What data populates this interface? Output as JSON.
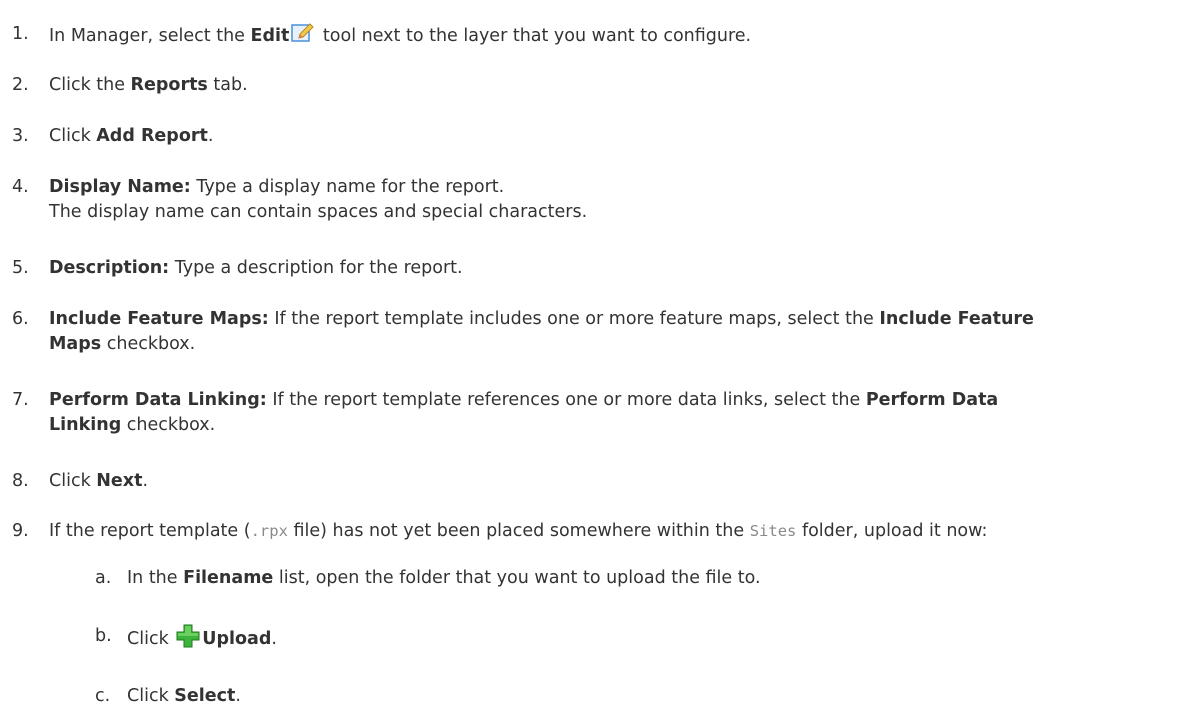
{
  "steps": [
    {
      "num": "1.",
      "pre": "In Manager, select the ",
      "bold": "Edit",
      "post": " tool next to the layer that you want to configure.",
      "icon": "edit-pencil-icon"
    },
    {
      "num": "2.",
      "pre": "Click the ",
      "bold": "Reports",
      "post": " tab."
    },
    {
      "num": "3.",
      "pre": "Click ",
      "bold": "Add Report",
      "post": "."
    },
    {
      "num": "4.",
      "bold": "Display Name:",
      "post": " Type a display name for the report.",
      "note": "The display name can contain spaces and special characters."
    },
    {
      "num": "5.",
      "bold": "Description:",
      "post": " Type a description for the report."
    },
    {
      "num": "6.",
      "bold": "Include Feature Maps:",
      "mid": " If the report template includes one or more feature maps, select the ",
      "bold2a": "Include Feature",
      "bold2b": "Maps",
      "post": " checkbox."
    },
    {
      "num": "7.",
      "bold": "Perform Data Linking:",
      "mid": " If the report template references one or more data links, select the ",
      "bold2a": "Perform Data",
      "bold2b": "Linking",
      "post": " checkbox."
    },
    {
      "num": "8.",
      "pre": "Click ",
      "bold": "Next",
      "post": "."
    },
    {
      "num": "9.",
      "pre": "If the report template (",
      "code1": ".rpx",
      "mid": " file) has not yet been placed somewhere within the ",
      "code2": "Sites",
      "post": " folder, upload it now:"
    }
  ],
  "substeps": [
    {
      "num": "a.",
      "pre": "In the ",
      "bold": "Filename",
      "post": " list, open the folder that you want to upload the file to."
    },
    {
      "num": "b.",
      "pre": "Click ",
      "bold": "Upload",
      "post": ".",
      "icon": "green-plus-icon"
    },
    {
      "num": "c.",
      "pre": "Click ",
      "bold": "Select",
      "post": "."
    }
  ],
  "colors": {
    "text": "#333333",
    "code": "#8a8a8a",
    "plus": "#3cb43c",
    "edit": "#4a90d9"
  }
}
